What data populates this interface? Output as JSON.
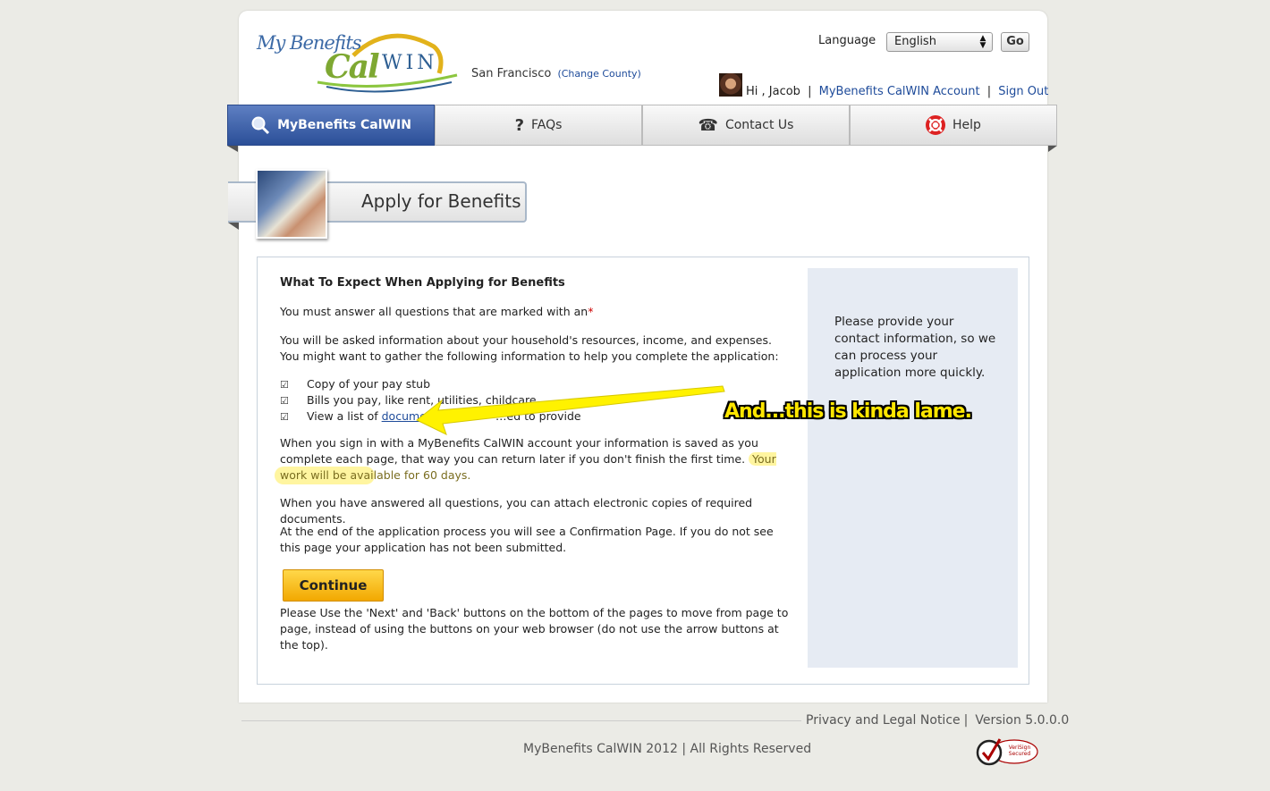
{
  "header": {
    "logo": {
      "line1": "My Benefits",
      "line2": "Cal",
      "line3": "WIN"
    },
    "county": "San Francisco",
    "change_county": "(Change County)",
    "language_label": "Language",
    "language_selected": "English",
    "go_label": "Go",
    "greeting": "Hi , Jacob",
    "account_link": "MyBenefits CalWIN Account",
    "signout_link": "Sign Out",
    "separator": "|"
  },
  "nav": {
    "tabs": [
      {
        "label": "MyBenefits CalWIN",
        "icon": "magnifier-icon"
      },
      {
        "label": "FAQs",
        "icon": "question-icon"
      },
      {
        "label": "Contact Us",
        "icon": "phone-icon"
      },
      {
        "label": "Help",
        "icon": "lifebuoy-icon"
      }
    ]
  },
  "banner": {
    "title": "Apply for Benefits",
    "image": "writing-hand-image"
  },
  "main": {
    "heading": "What To Expect When Applying for Benefits",
    "required_note": "You must answer all questions that are marked with an",
    "required_marker": "*",
    "intro": "You will be asked information about your household's resources, income, and expenses. You might want to gather the following information to help you complete the application:",
    "checklist": [
      {
        "text": "Copy of your pay stub"
      },
      {
        "text": "Bills you pay, like rent, utilities, childcare"
      },
      {
        "prefix": "View a list of ",
        "link": "documents",
        "suffix": " you may need to provide",
        "visible_prefix": "View a list of ",
        "visible_link": "documer",
        "visible_tail": "…ed to provide"
      }
    ],
    "save_text_1": "When you sign in with a MyBenefits CalWIN account your information is saved as you complete each page, that way you can return later if you don't finish the first time.",
    "save_text_hl_1": "Your work will be",
    "save_text_hl_2": "available for 60 days.",
    "attach_text": "When you have answered all questions, you can attach electronic copies of required documents.",
    "confirm_text": "At the end of the application process you will see a Confirmation Page. If you do not see this page your application has not been submitted.",
    "continue_label": "Continue",
    "nav_note": "Please Use the 'Next' and 'Back' buttons on the bottom of the pages to move from page to page, instead of using the buttons on your web browser (do not use the arrow buttons at the top)."
  },
  "sidebar": {
    "text": "Please provide your contact information, so we can process your application more quickly."
  },
  "annotation": {
    "text": "And...this is kinda lame.",
    "color": "#ffe600"
  },
  "footer": {
    "privacy": "Privacy and Legal Notice",
    "separator": "|",
    "version": "Version 5.0.0.0",
    "copyright": "MyBenefits CalWIN 2012 | All Rights Reserved",
    "seal": "VeriSign Secured"
  },
  "colors": {
    "accent": "#2b4f98",
    "link": "#1e4b9a",
    "button": "#f2a800",
    "sidebar_bg": "#e6ebf3"
  }
}
